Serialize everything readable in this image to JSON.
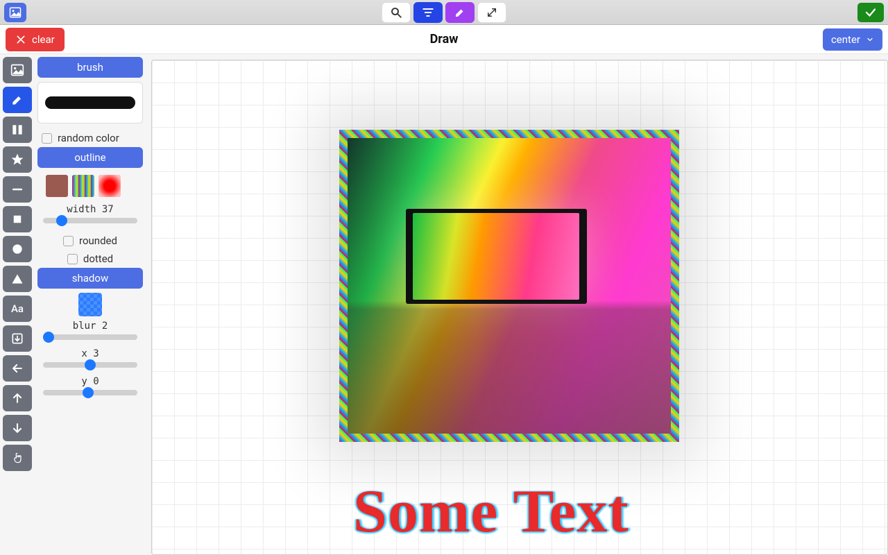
{
  "topbar": {
    "search_icon": "search",
    "filter_icon": "filter",
    "draw_icon": "brush",
    "expand_icon": "expand",
    "confirm_icon": "check"
  },
  "secbar": {
    "clear_label": "clear",
    "title": "Draw",
    "dropdown_label": "center"
  },
  "toolrail": {
    "items": [
      {
        "name": "image-tool",
        "icon": "picture"
      },
      {
        "name": "draw-tool",
        "icon": "brush",
        "active": true
      },
      {
        "name": "columns-tool",
        "icon": "columns"
      },
      {
        "name": "star-tool",
        "icon": "star"
      },
      {
        "name": "line-tool",
        "icon": "minus"
      },
      {
        "name": "square-tool",
        "icon": "square"
      },
      {
        "name": "circle-tool",
        "icon": "circle"
      },
      {
        "name": "triangle-tool",
        "icon": "triangle"
      },
      {
        "name": "text-tool",
        "icon": "Aa"
      },
      {
        "name": "download-tool",
        "icon": "download"
      },
      {
        "name": "back-tool",
        "icon": "arrow-left"
      },
      {
        "name": "up-tool",
        "icon": "arrow-up"
      },
      {
        "name": "down-tool",
        "icon": "arrow-down"
      },
      {
        "name": "pointer-tool",
        "icon": "pointer"
      }
    ]
  },
  "panel": {
    "brush_header": "brush",
    "random_color_label": "random color",
    "outline_header": "outline",
    "width_label": "width 37",
    "width_value": 37,
    "rounded_label": "rounded",
    "dotted_label": "dotted",
    "shadow_header": "shadow",
    "blur_label": "blur 2",
    "blur_value": 2,
    "x_label": "x 3",
    "x_value": 3,
    "y_label": "y 0",
    "y_value": 0
  },
  "canvas": {
    "text": "Some Text"
  },
  "colors": {
    "accent_blue": "#4d6de3",
    "active_blue": "#2556e8",
    "purple": "#a040f0",
    "red": "#e83a3a",
    "green": "#1a8a1a",
    "slider_blue": "#1c78ff"
  }
}
